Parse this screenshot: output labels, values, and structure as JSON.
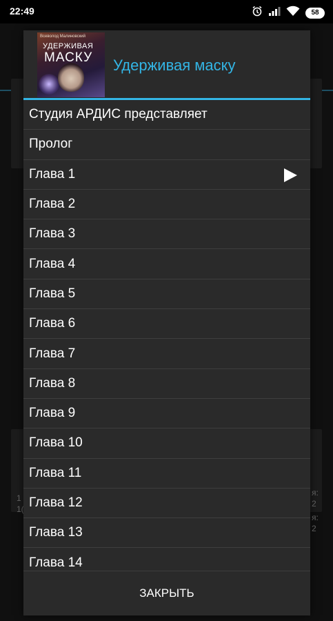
{
  "status_bar": {
    "time": "22:49",
    "battery": "58",
    "icons": [
      "alarm-icon",
      "signal-icon",
      "wifi-icon",
      "battery-icon"
    ]
  },
  "dialog": {
    "title": "Удерживая маску",
    "cover": {
      "author": "Всеволод Малиновский",
      "title_line1": "УДЕРЖИВАЯ",
      "title_line2": "МАСКУ"
    },
    "chapters": [
      {
        "label": "Студия АРДИС представляет",
        "playing": false
      },
      {
        "label": "Пролог",
        "playing": false
      },
      {
        "label": "Глава 1",
        "playing": true
      },
      {
        "label": "Глава 2",
        "playing": false
      },
      {
        "label": "Глава 3",
        "playing": false
      },
      {
        "label": "Глава 4",
        "playing": false
      },
      {
        "label": "Глава 5",
        "playing": false
      },
      {
        "label": "Глава 6",
        "playing": false
      },
      {
        "label": "Глава 7",
        "playing": false
      },
      {
        "label": "Глава 8",
        "playing": false
      },
      {
        "label": "Глава 9",
        "playing": false
      },
      {
        "label": "Глава 10",
        "playing": false
      },
      {
        "label": "Глава 11",
        "playing": false
      },
      {
        "label": "Глава 12",
        "playing": false
      },
      {
        "label": "Глава 13",
        "playing": false
      },
      {
        "label": "Глава 14",
        "playing": false
      }
    ],
    "close_label": "ЗАКРЫТЬ"
  },
  "background": {
    "left_text": [
      "1",
      "1("
    ],
    "right_text": [
      "я:",
      "2",
      "я:",
      "2"
    ]
  },
  "colors": {
    "accent": "#33b5e5",
    "dialog_bg": "#2a2a2a",
    "divider": "#3e3e3e"
  }
}
